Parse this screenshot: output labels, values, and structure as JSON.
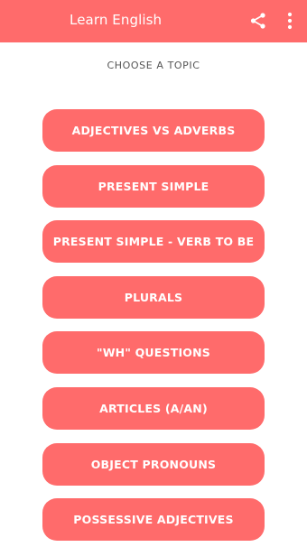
{
  "appbar": {
    "title": "Learn English",
    "color": "#ff6b6b",
    "icons": [
      "share-icon",
      "more-vert-icon"
    ]
  },
  "subtitle": "CHOOSE A TOPIC",
  "topics": [
    {
      "label": "ADJECTIVES VS ADVERBS"
    },
    {
      "label": "PRESENT SIMPLE"
    },
    {
      "label": "PRESENT SIMPLE - VERB TO BE"
    },
    {
      "label": "PLURALS"
    },
    {
      "label": "\"WH\" QUESTIONS"
    },
    {
      "label": "ARTICLES (A/AN)"
    },
    {
      "label": "OBJECT PRONOUNS"
    },
    {
      "label": "POSSESSIVE ADJECTIVES"
    }
  ],
  "colors": {
    "accent": "#ff6b6b",
    "text_on_accent": "#ffffff"
  }
}
